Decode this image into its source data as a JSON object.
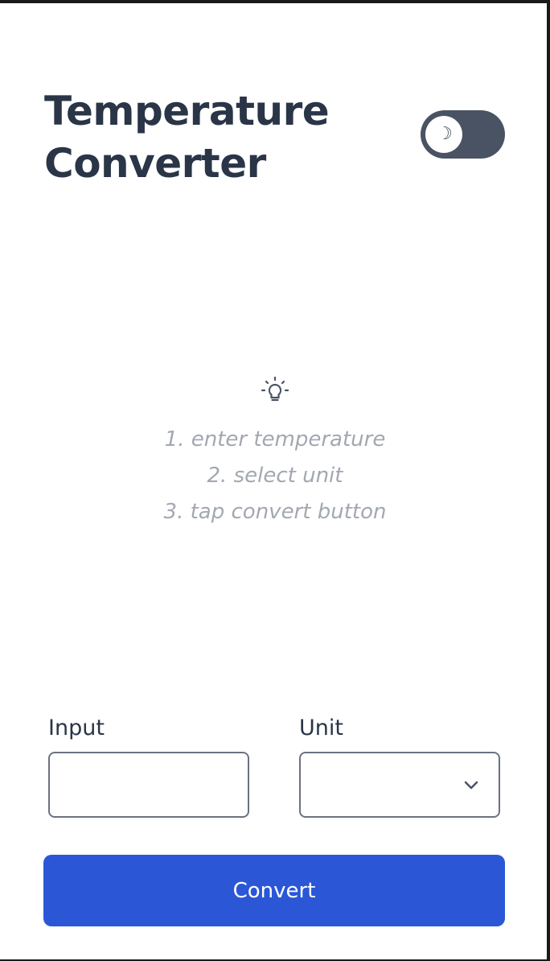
{
  "header": {
    "title_line1": "Temperature",
    "title_line2": "Converter"
  },
  "theme_toggle": {
    "icon": "moon-icon",
    "glyph": "☽",
    "enabled": false,
    "colors": {
      "track": "#4a5363",
      "knob": "#ffffff"
    }
  },
  "instructions": {
    "icon": "lightbulb-icon",
    "steps": [
      "1. enter temperature",
      "2. select unit",
      "3. tap convert button"
    ]
  },
  "form": {
    "input_label": "Input",
    "input_value": "",
    "input_placeholder": "",
    "unit_label": "Unit",
    "unit_value": ""
  },
  "actions": {
    "convert_label": "Convert"
  },
  "colors": {
    "primary": "#2b57d6",
    "heading": "#2a3547",
    "hint": "#a3a8b0",
    "border": "#6b7280"
  }
}
